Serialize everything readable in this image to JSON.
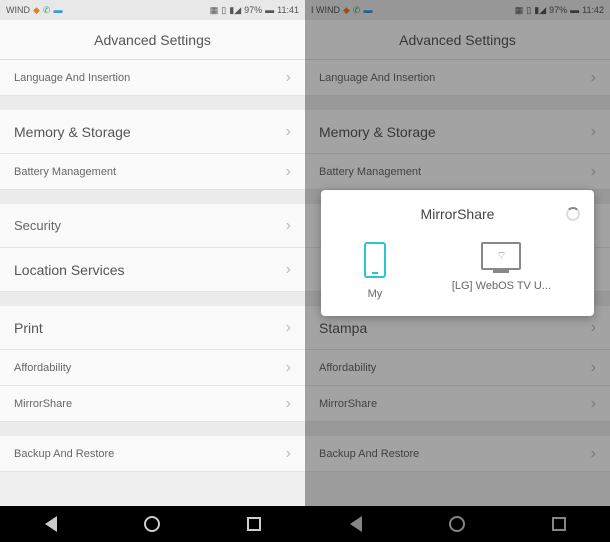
{
  "status": {
    "carrier_left": "WIND",
    "carrier_right": "I WIND",
    "battery": "97%",
    "time_left": "11:41",
    "time_right": "11:42"
  },
  "header": {
    "title": "Advanced Settings"
  },
  "left_rows": {
    "lang": "Language And Insertion",
    "memory": "Memory & Storage",
    "battery": "Battery Management",
    "security": "Security",
    "location": "Location Services",
    "print": "Print",
    "afford": "Affordability",
    "mirror": "MirrorShare",
    "backup": "Backup And Restore"
  },
  "right_rows": {
    "lang": "Language And Insertion",
    "memory": "Memory & Storage",
    "battery": "Battery Management",
    "stampa": "Stampa",
    "afford": "Affordability",
    "mirror": "MirrorShare",
    "backup": "Backup And Restore"
  },
  "modal": {
    "title": "MirrorShare",
    "dev1": "My",
    "dev2": "[LG] WebOS TV U..."
  }
}
